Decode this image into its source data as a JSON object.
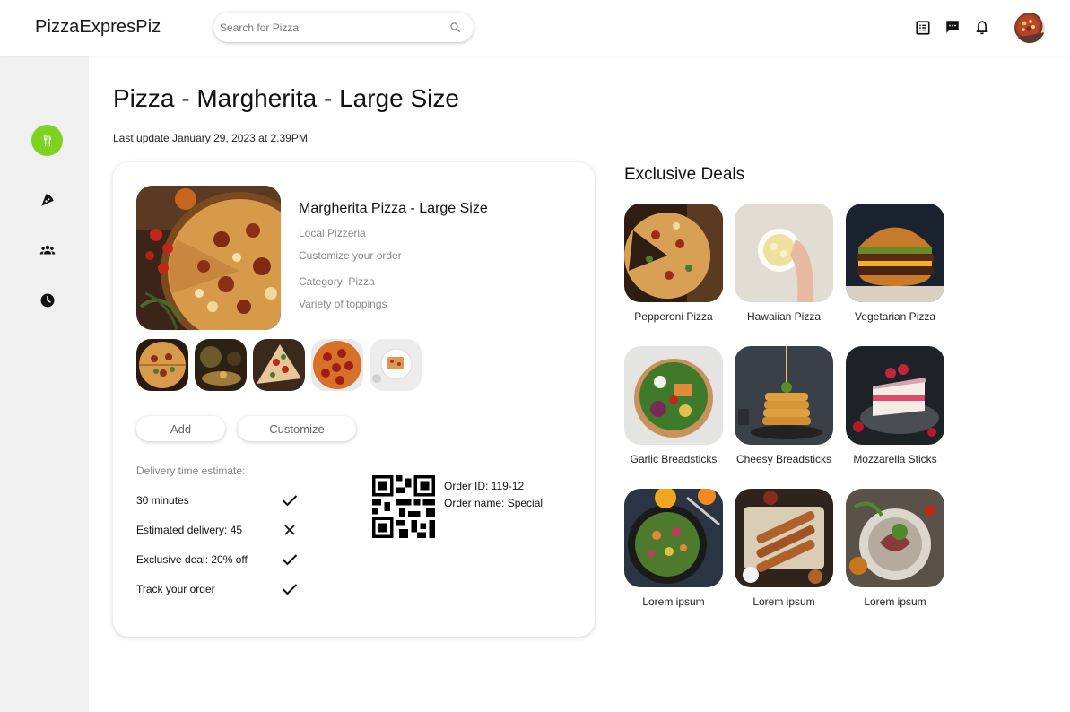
{
  "header": {
    "logo": "PizzaExpresPiz",
    "search_placeholder": "Search for Pizza"
  },
  "page": {
    "title": "Pizza - Margherita - Large Size",
    "last_update": "Last update January 29, 2023 at 2.39PM"
  },
  "product": {
    "name": "Margherita Pizza - Large Size",
    "lines": [
      "Local Pizzeria",
      "Customize your order",
      "Category: Pizza",
      "Variety of toppings"
    ],
    "add_label": "Add",
    "customize_label": "Customize",
    "delivery_heading": "Delivery time estimate:",
    "features": [
      {
        "label": "30 minutes",
        "status": "check"
      },
      {
        "label": "Estimated delivery: 45",
        "status": "cross"
      },
      {
        "label": "Exclusive deal: 20% off",
        "status": "check"
      },
      {
        "label": "Track your order",
        "status": "check"
      }
    ],
    "order_id": "Order ID: 119-12",
    "order_name": "Order name: Special"
  },
  "deals": {
    "title": "Exclusive Deals",
    "items": [
      {
        "label": "Pepperoni Pizza"
      },
      {
        "label": "Hawaiian Pizza"
      },
      {
        "label": "Vegetarian Pizza"
      },
      {
        "label": "Garlic Breadsticks"
      },
      {
        "label": "Cheesy Breadsticks"
      },
      {
        "label": "Mozzarella Sticks"
      },
      {
        "label": "Lorem ipsum"
      },
      {
        "label": "Lorem ipsum"
      },
      {
        "label": "Lorem ipsum"
      }
    ]
  },
  "colors": {
    "accent": "#7ed321",
    "sidebar_bg": "#f0f0f0"
  }
}
